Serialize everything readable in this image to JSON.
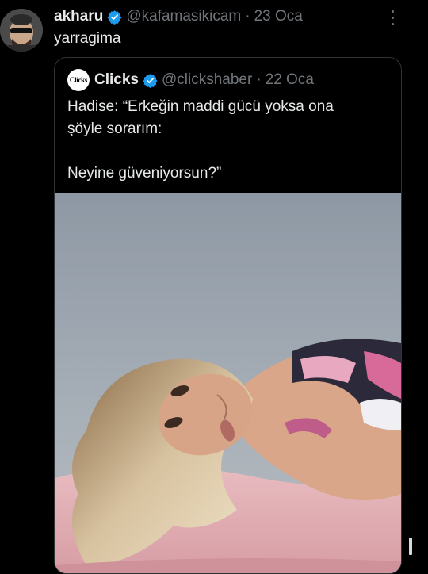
{
  "tweet": {
    "author_name": "akharu",
    "handle": "@kafamasikicam",
    "separator": "·",
    "date": "23 Oca",
    "text": "yarragima",
    "icons": {
      "avatar": "avatar-man-sunglasses",
      "verified": "verified-badge-icon",
      "more": "more-vertical-icon"
    }
  },
  "quote": {
    "avatar_text": "Clicks",
    "author_name": "Clicks",
    "handle": "@clickshaber",
    "separator": "·",
    "date": "22 Oca",
    "text_lines": [
      "Hadise: “Erkeğin maddi gücü yoksa ona",
      "şöyle sorarım:",
      "Neyine güveniyorsun?”"
    ]
  },
  "colors": {
    "background": "#000000",
    "text": "#e7e9ea",
    "muted": "#71767b",
    "verified": "#1d9bf0",
    "border": "#2f3336"
  }
}
